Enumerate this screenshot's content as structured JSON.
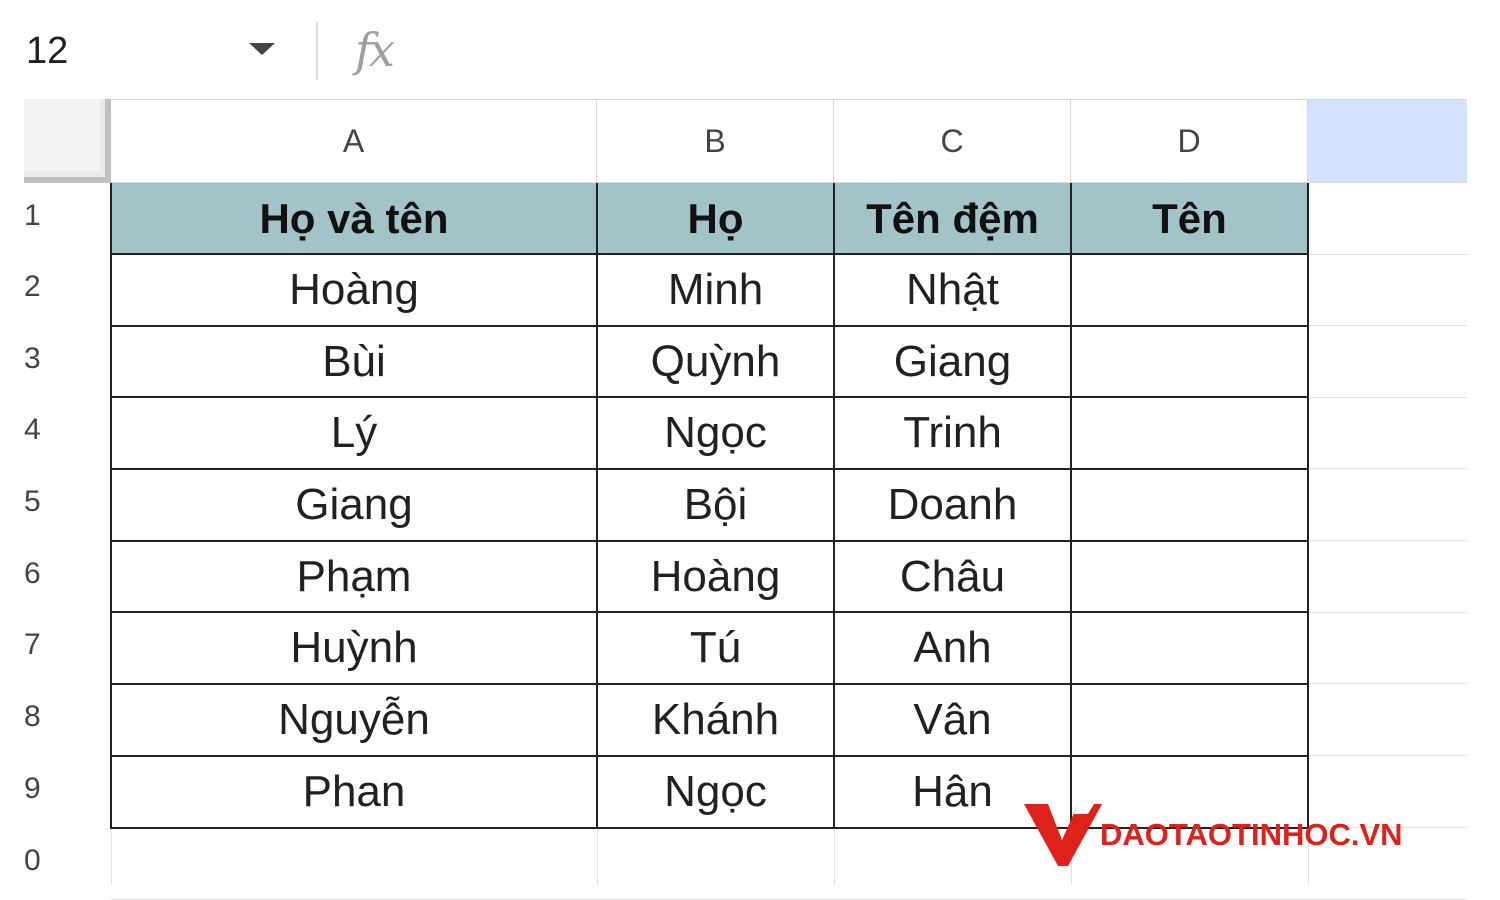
{
  "formula_bar": {
    "name_box": "12",
    "fx_label": "fx",
    "formula": ""
  },
  "columns": [
    "A",
    "B",
    "C",
    "D"
  ],
  "row_numbers": [
    "1",
    "2",
    "3",
    "4",
    "5",
    "6",
    "7",
    "8",
    "9",
    "0"
  ],
  "table": {
    "headers": [
      "Họ và tên",
      "Họ",
      "Tên đệm",
      "Tên"
    ],
    "rows": [
      [
        "Hoàng",
        "Minh",
        "Nhật",
        ""
      ],
      [
        "Bùi",
        "Quỳnh",
        "Giang",
        ""
      ],
      [
        "Lý",
        "Ngọc",
        "Trinh",
        ""
      ],
      [
        "Giang",
        "Bội",
        "Doanh",
        ""
      ],
      [
        "Phạm",
        "Hoàng",
        "Châu",
        ""
      ],
      [
        "Huỳnh",
        "Tú",
        "Anh",
        ""
      ],
      [
        "Nguyễn",
        "Khánh",
        "Vân",
        ""
      ],
      [
        "Phan",
        "Ngọc",
        "Hân",
        ""
      ]
    ]
  },
  "colors": {
    "header_fill": "#a2c4c9",
    "selection_blue": "#d3e3fd",
    "watermark_red": "#e0201b"
  },
  "watermark": {
    "text": "DAOTAOTINHOC.VN",
    "logo": "v-logo-icon"
  }
}
